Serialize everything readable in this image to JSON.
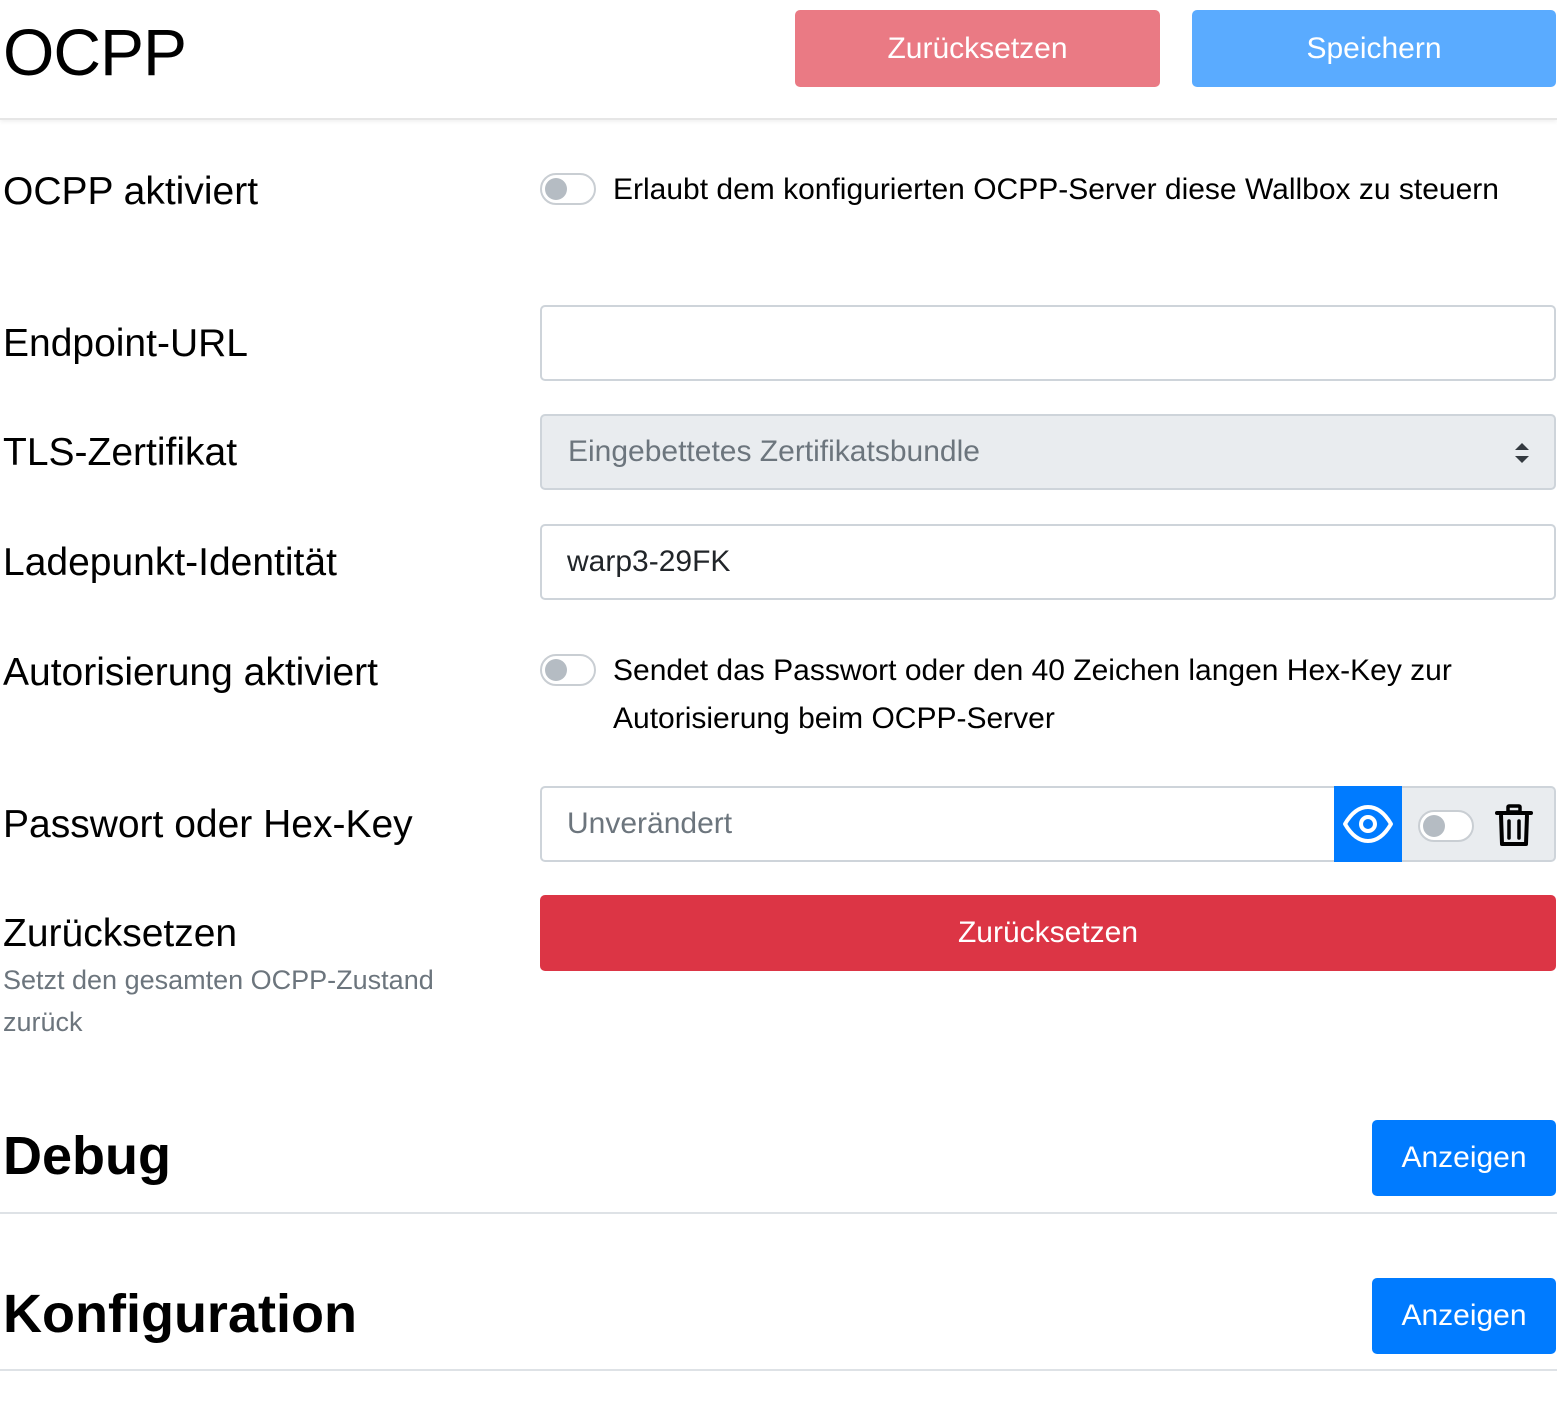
{
  "header": {
    "title": "OCPP",
    "reset_label": "Zurücksetzen",
    "save_label": "Speichern"
  },
  "colors": {
    "reset_light": "#ea7a84",
    "save_light": "#5aabff",
    "primary": "#007bff",
    "danger": "#dc3545",
    "muted_text": "#6c757d",
    "disabled_bg": "#e9ecef"
  },
  "form": {
    "ocpp_enabled": {
      "label": "OCPP aktiviert",
      "checked": false,
      "description": "Erlaubt dem konfigurierten OCPP-Server diese Wallbox zu steuern"
    },
    "endpoint_url": {
      "label": "Endpoint-URL",
      "value": ""
    },
    "tls_cert": {
      "label": "TLS-Zertifikat",
      "selected": "Eingebettetes Zertifikatsbundle"
    },
    "charge_point_identity": {
      "label": "Ladepunkt-Identität",
      "value": "warp3-29FK"
    },
    "auth_enabled": {
      "label": "Autorisierung aktiviert",
      "checked": false,
      "description": "Sendet das Passwort oder den 40 Zeichen langen Hex-Key zur Autorisierung beim OCPP-Server"
    },
    "password": {
      "label": "Passwort oder Hex-Key",
      "placeholder": "Unverändert",
      "show_icon": "eye-icon",
      "clear_icon": "trash-icon",
      "clear_checked": false
    },
    "reset": {
      "label": "Zurücksetzen",
      "sublabel": "Setzt den gesamten OCPP-Zustand zurück",
      "button_label": "Zurücksetzen"
    }
  },
  "sections": {
    "debug": {
      "title": "Debug",
      "button_label": "Anzeigen"
    },
    "config": {
      "title": "Konfiguration",
      "button_label": "Anzeigen"
    }
  }
}
